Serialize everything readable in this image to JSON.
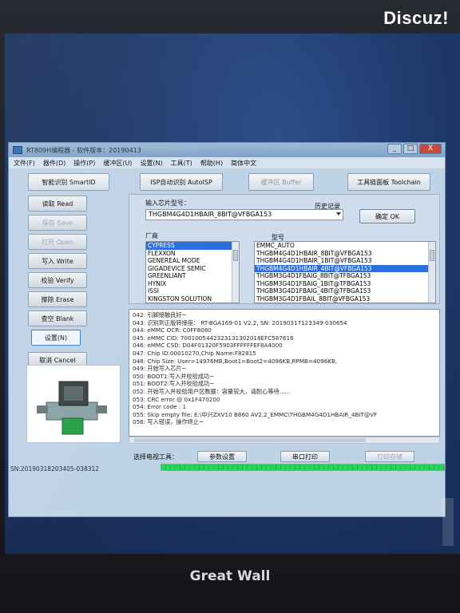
{
  "watermark": "Discuz!",
  "monitor_brand": "Great Wall",
  "window": {
    "title": "RT809H编程器 - 软件版本：20190413",
    "controls": [
      "_",
      "□",
      "X"
    ]
  },
  "menu": [
    "文件(F)",
    "器件(D)",
    "操作(P)",
    "缓冲区(U)",
    "设置(N)",
    "工具(T)",
    "帮助(H)",
    "简体中文"
  ],
  "toolbar": {
    "smartid": "智能识别 SmartID",
    "autoisp": "ISP自动识别 AutoISP",
    "buffer": "缓冲区 Buffer",
    "toolchain": "工具链面板 Toolchain"
  },
  "sidebar": [
    "读取 Read",
    "保存 Save",
    "打开 Open",
    "写入 Write",
    "校验 Verify",
    "擦除 Erase",
    "查空 Blank",
    "设置(N)",
    "取消 Cancel"
  ],
  "chip_panel": {
    "input_label": "输入芯片型号：",
    "history_label": "历史记录",
    "selected_chip": "THGBM4G4D1HBAIR_8BIT@VFBGA153",
    "ok_button": "确定 OK",
    "vendor_label": "厂商",
    "model_label": "型号",
    "vendors": [
      "CYPRESS",
      "FLEXXON",
      "GENEREAL MODE",
      "GIGADEVICE SEMIC",
      "GREENLIANT",
      "HYNIX",
      "ISSI",
      "KINGSTON SOLUTION"
    ],
    "vendor_selected": "CYPRESS",
    "models": [
      "EMMC_AUTO",
      "THGBM4G4D1HBAIR_8BIT@VFBGA153",
      "THGBM4G4D1HBAIR_1BIT@VFBGA153",
      "THGBM4G4D1HBAIR_4BIT@VFBGA153",
      "THGBM3G4D1FBAIG_8BIT@TFBGA153",
      "THGBM3G4D1FBAIG_1BIT@TFBGA153",
      "THGBM3G4D1FBAIG_4BIT@TFBGA153",
      "THGBM3G4D1FBAIL_8BIT@VFBGA153"
    ],
    "model_selected": "THGBM4G4D1HBAIR_4BIT@VFBGA153"
  },
  "log": [
    "042: 引脚接触良好~",
    "043: 识别到正版转接座：  RT-BGA169-01 V2.2,  SN: 20190317123349-030654",
    "044: eMMC OCR: C0FF8080",
    "045: eMMC CID: 7001005442323131302018EFC587616",
    "046: eMMC CSD: D04F01320F5903FFFFFFEF8A4000",
    "047: Chip ID:00010270,Chip Name:F82815",
    "048: Chip Size: User=14976MB,Boot1=Boot2=4096KB,RPMB=4096KB,",
    "049: 开始写入芯片~",
    "050: BOOT1:写入并校验成功~",
    "051: BOOT2:写入并校验成功~",
    "052: 开始写入并校验用户区数据：容量较大，请耐心等待......",
    "053: CRC error @ 0x1F470200",
    "054: Error code : 1",
    "055: Skip empty file: E:\\中兴ZXV10 B860 AV2.2_EMMC\\THGBM4G4D1HBAIR_4BIT@VF",
    "056: 写入错误，操作终止~"
  ],
  "bottom": {
    "label": "选择电视工具：",
    "btn1": "参数设置",
    "btn2": "串口打印",
    "btn3": "打印存储"
  },
  "progress": 1.0,
  "status": "SN:20190318203405-038312"
}
